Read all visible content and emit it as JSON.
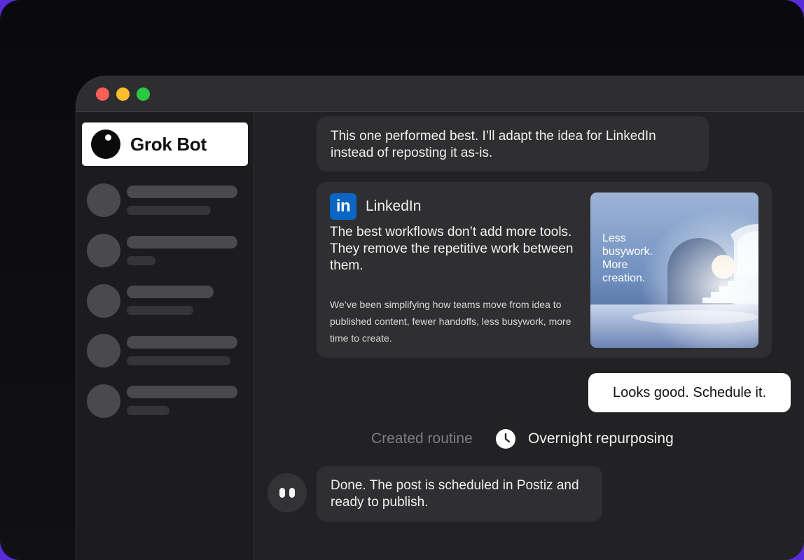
{
  "window": {
    "controls": [
      "close",
      "minimize",
      "maximize"
    ]
  },
  "sidebar": {
    "bot_name": "Grok Bot",
    "placeholder_items": 5
  },
  "chat": {
    "message_1": "This one performed best. I’ll adapt the idea for LinkedIn instead of reposting it as-is.",
    "linkedin_post": {
      "platform": "LinkedIn",
      "logo_text": "in",
      "headline": "The best workflows don’t add more tools.",
      "headline_2": "They remove the repetitive work between them.",
      "body": "We’ve been simplifying how teams move from idea to published content, fewer handoffs, less busywork, more time to create.",
      "image_line_1": "Less",
      "image_line_2": "busywork.",
      "image_line_3": "More",
      "image_line_4": "creation."
    },
    "user_reply": "Looks good. Schedule it.",
    "routine": {
      "label": "Created routine",
      "name": "Overnight repurposing"
    },
    "message_done": "Done. The post is scheduled in Postiz and ready to publish."
  },
  "colors": {
    "background_accent": "#5b2bd9",
    "linkedin_blue": "#0a66c2",
    "close": "#fe5f57",
    "minimize": "#febc2e",
    "maximize": "#28c840"
  }
}
